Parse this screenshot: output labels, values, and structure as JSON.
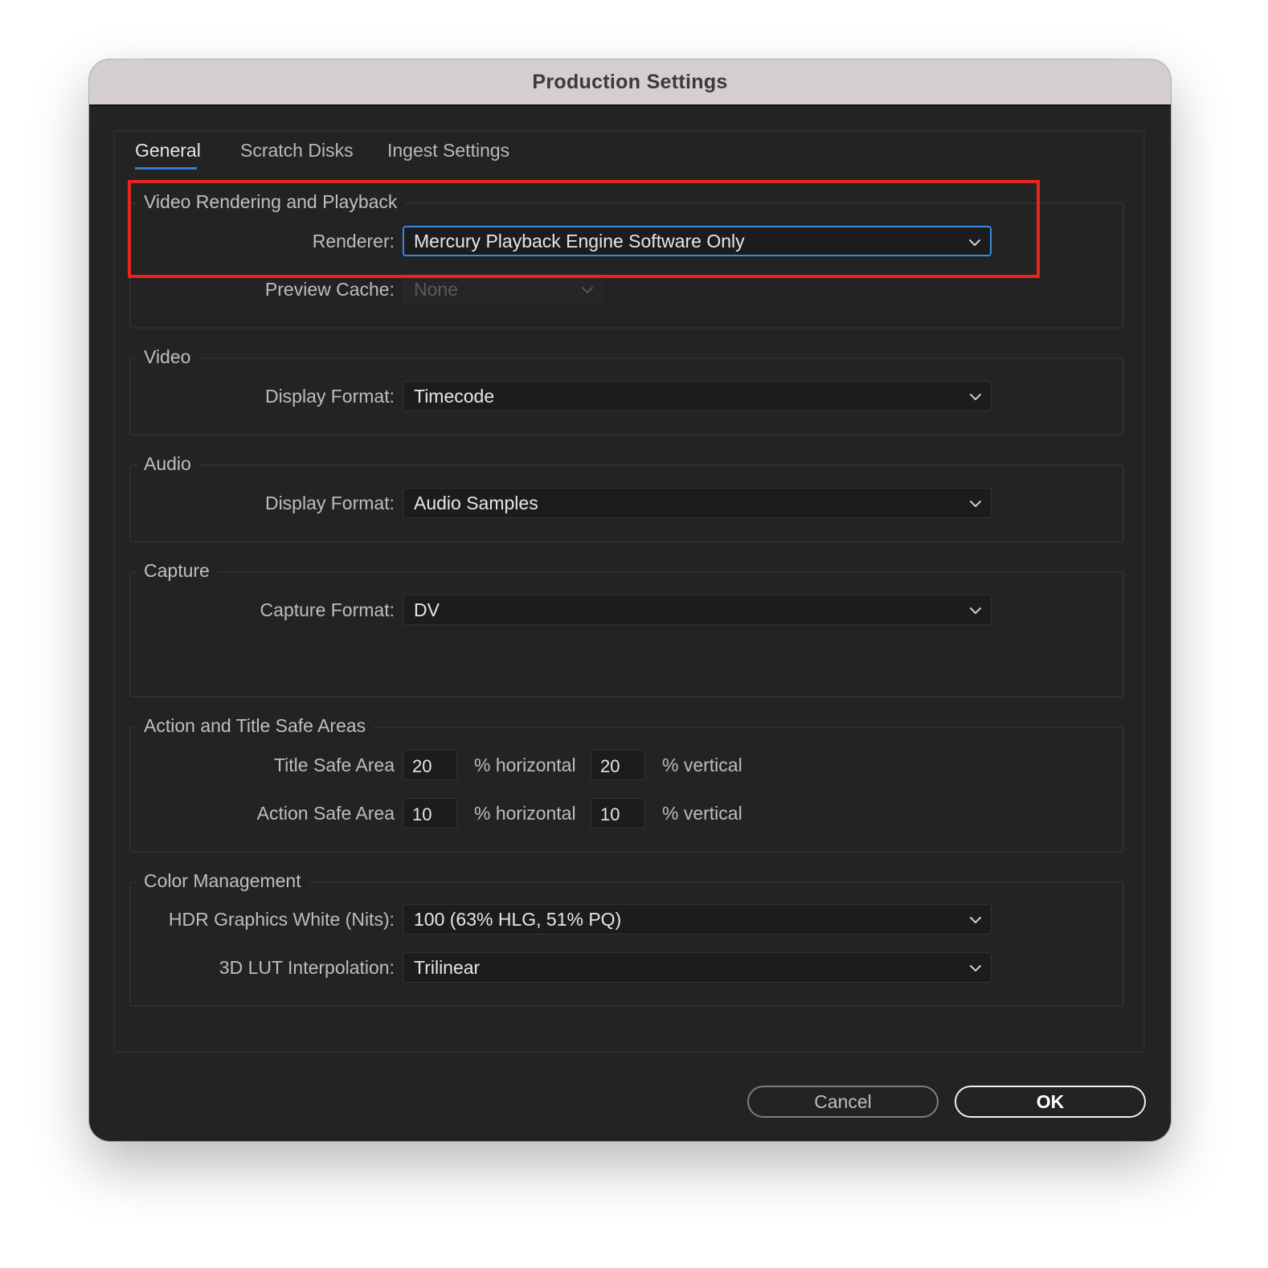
{
  "window": {
    "title": "Production Settings"
  },
  "tabs": [
    "General",
    "Scratch Disks",
    "Ingest Settings"
  ],
  "active_tab": "General",
  "sections": {
    "video_rendering": {
      "heading": "Video Rendering and Playback",
      "renderer_label": "Renderer:",
      "renderer_value": "Mercury Playback Engine Software Only",
      "preview_cache_label": "Preview Cache:",
      "preview_cache_value": "None"
    },
    "video": {
      "heading": "Video",
      "display_format_label": "Display Format:",
      "display_format_value": "Timecode"
    },
    "audio": {
      "heading": "Audio",
      "display_format_label": "Display Format:",
      "display_format_value": "Audio Samples"
    },
    "capture": {
      "heading": "Capture",
      "capture_format_label": "Capture Format:",
      "capture_format_value": "DV"
    },
    "safe_areas": {
      "heading": "Action and Title Safe Areas",
      "title_safe_label": "Title Safe Area",
      "title_safe_horizontal": "20",
      "title_safe_vertical": "20",
      "action_safe_label": "Action Safe Area",
      "action_safe_horizontal": "10",
      "action_safe_vertical": "10",
      "horizontal_suffix": "% horizontal",
      "vertical_suffix": "% vertical"
    },
    "color_management": {
      "heading": "Color Management",
      "hdr_label": "HDR Graphics White (Nits):",
      "hdr_value": "100 (63% HLG, 51% PQ)",
      "lut_label": "3D LUT Interpolation:",
      "lut_value": "Trilinear"
    }
  },
  "buttons": {
    "cancel": "Cancel",
    "ok": "OK"
  },
  "colors": {
    "accent_blue": "#2f7fd8",
    "highlight_red": "#e8251d",
    "dialog_bg": "#232323",
    "titlebar_bg": "#d4cece"
  },
  "icons": {
    "dropdown": "chevron-down-icon"
  }
}
